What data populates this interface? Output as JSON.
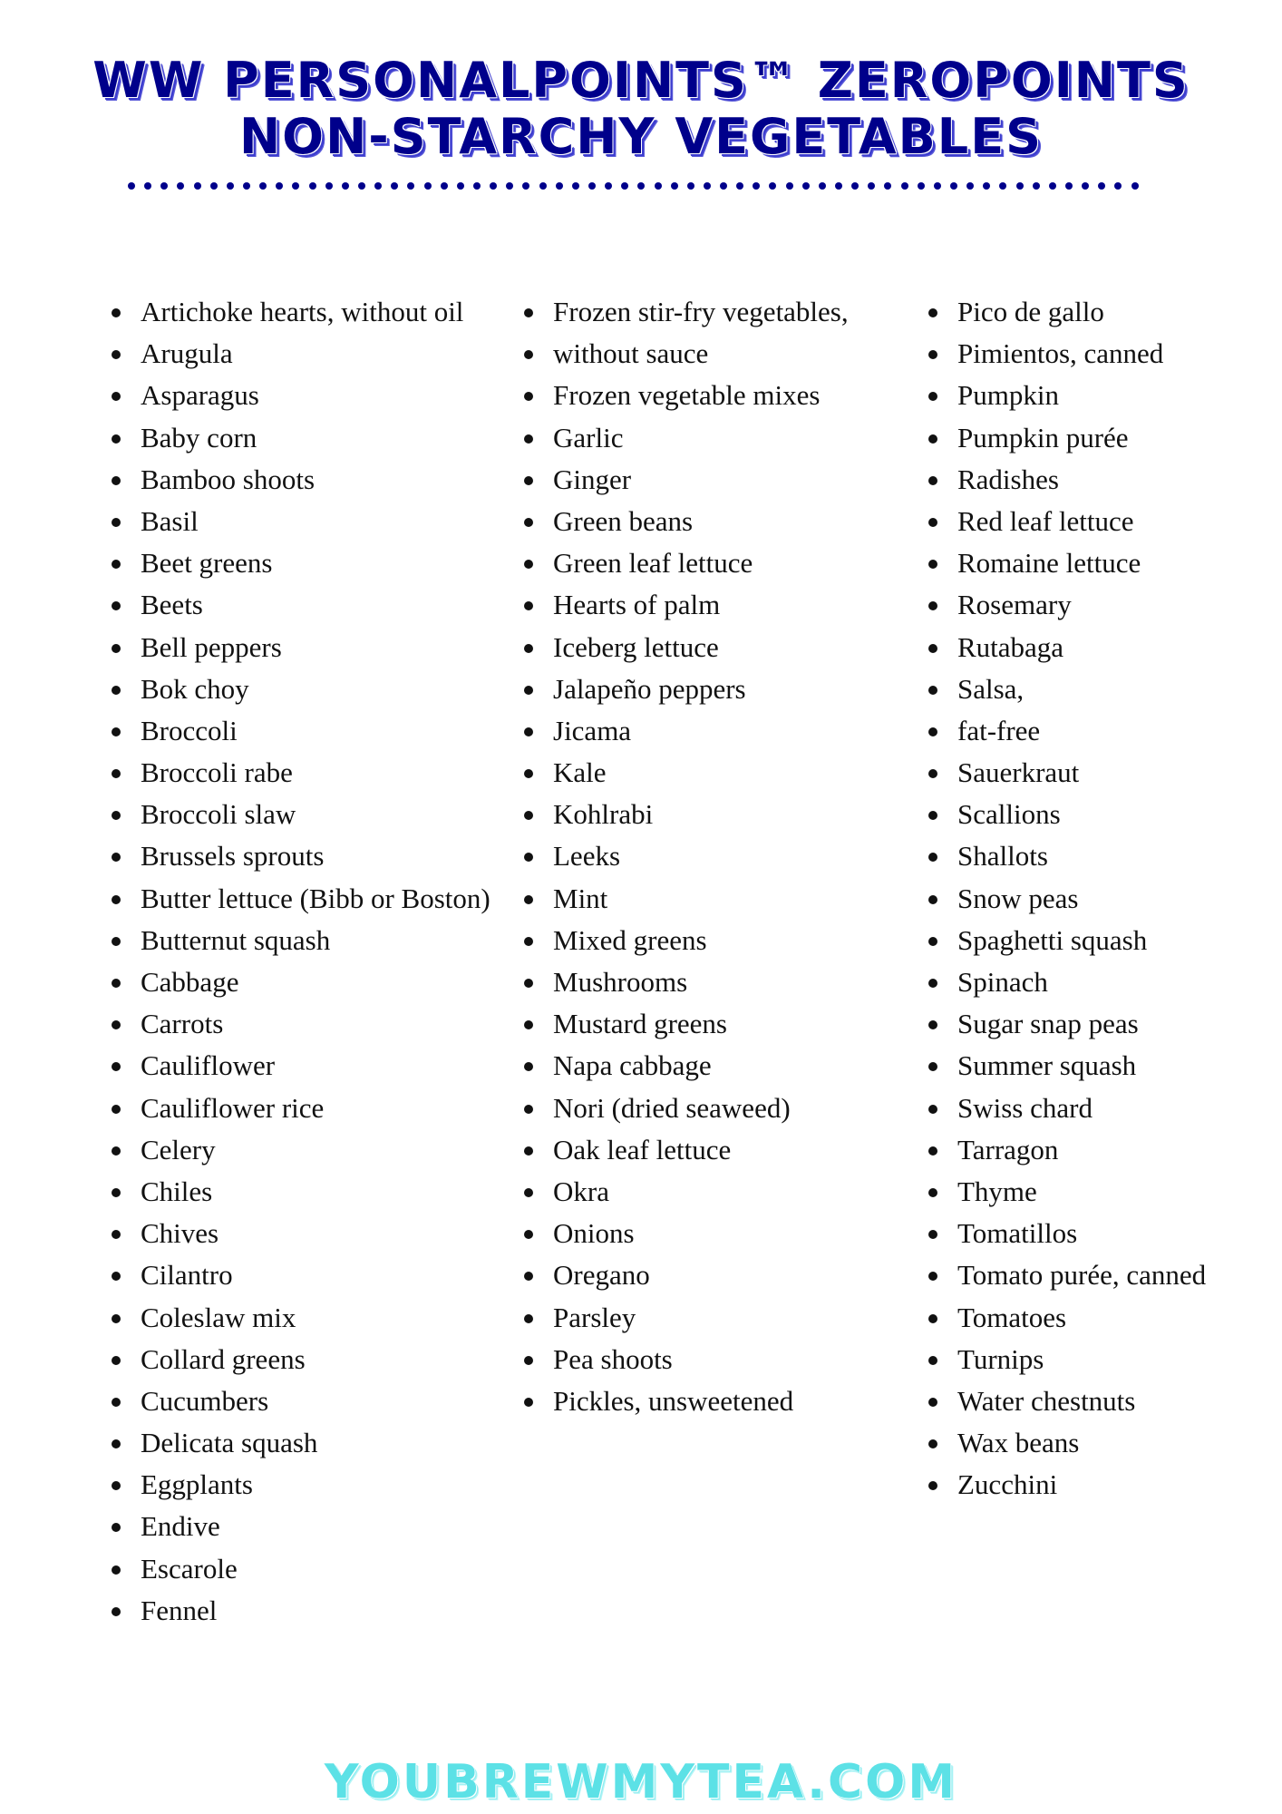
{
  "header": {
    "title_lines": [
      "WW PERSONALPOINTS™ ZEROPOINTS",
      "NON-STARCHY VEGETABLES"
    ]
  },
  "colors": {
    "title": "#00008b",
    "title_shadow": "#3d3dcf",
    "divider_dots": "#00008b",
    "footer": "#5ce1e6",
    "list_text": "#111111"
  },
  "lists": {
    "column_1": [
      "Artichoke hearts, without oil",
      "Arugula",
      "Asparagus",
      "Baby corn",
      "Bamboo shoots",
      "Basil",
      "Beet greens",
      "Beets",
      "Bell peppers",
      "Bok choy",
      "Broccoli",
      "Broccoli rabe",
      "Broccoli slaw",
      "Brussels sprouts",
      "Butter lettuce (Bibb or Boston)",
      "Butternut squash",
      "Cabbage",
      "Carrots",
      "Cauliflower",
      "Cauliflower rice",
      "Celery",
      "Chiles",
      "Chives",
      "Cilantro",
      "Coleslaw mix",
      "Collard greens",
      "Cucumbers",
      "Delicata squash",
      "Eggplants",
      "Endive",
      "Escarole",
      "Fennel"
    ],
    "column_2": [
      "Frozen stir-fry vegetables,",
      "without sauce",
      "Frozen vegetable mixes",
      "Garlic",
      "Ginger",
      "Green beans",
      "Green leaf lettuce",
      "Hearts of palm",
      "Iceberg lettuce",
      "Jalapeño peppers",
      "Jicama",
      "Kale",
      "Kohlrabi",
      "Leeks",
      "Mint",
      "Mixed greens",
      "Mushrooms",
      "Mustard greens",
      "Napa cabbage",
      "Nori (dried seaweed)",
      "Oak leaf lettuce",
      "Okra",
      "Onions",
      "Oregano",
      "Parsley",
      "Pea shoots",
      "Pickles, unsweetened"
    ],
    "column_3": [
      "Pico de gallo",
      "Pimientos, canned",
      "Pumpkin",
      "Pumpkin purée",
      "Radishes",
      "Red leaf lettuce",
      "Romaine lettuce",
      "Rosemary",
      "Rutabaga",
      "Salsa,",
      "fat-free",
      "Sauerkraut",
      "Scallions",
      "Shallots",
      "Snow peas",
      "Spaghetti squash",
      "Spinach",
      "Sugar snap peas",
      "Summer squash",
      "Swiss chard",
      "Tarragon",
      "Thyme",
      "Tomatillos",
      "Tomato purée, canned",
      "Tomatoes",
      "Turnips",
      "Water chestnuts",
      "Wax beans",
      "Zucchini"
    ]
  },
  "footer": {
    "website": "YOUBREWMYTEA.COM"
  }
}
